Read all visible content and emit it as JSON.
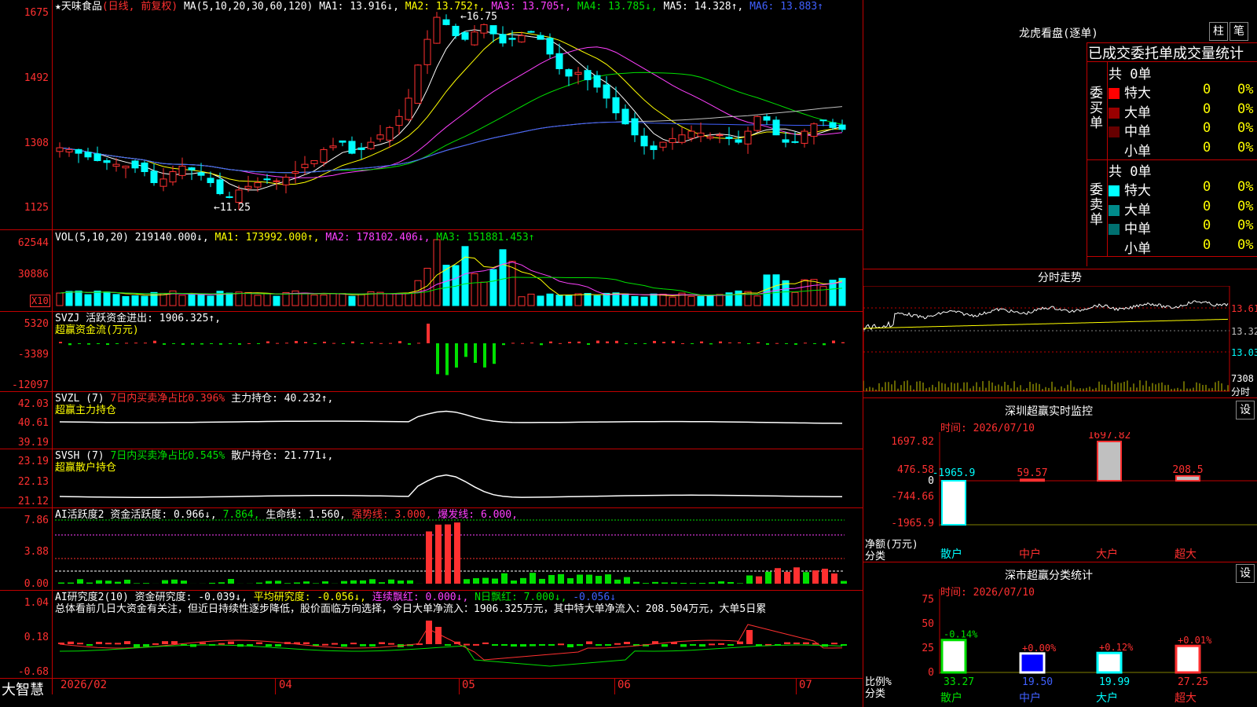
{
  "header": {
    "star": "★",
    "stock": "天味食品",
    "mode": "(日线, 前复权)",
    "ma_label": "MA(5,10,20,30,60,120)",
    "ma1": "MA1: 13.916↓,",
    "ma2": "MA2: 13.752↑,",
    "ma3": "MA3: 13.705↑,",
    "ma4": "MA4: 13.785↓,",
    "ma5": "MA5: 14.328↑,",
    "ma6": "MA6: 13.883↑",
    "high_mark": "16.75",
    "low_mark": "11.25"
  },
  "price_axis": [
    "1675",
    "1492",
    "1308",
    "1125"
  ],
  "vol": {
    "label": "VOL(5,10,20)",
    "val": "219140.000↓,",
    "ma1": "MA1: 173992.000↑,",
    "ma2": "MA2: 178102.406↓,",
    "ma3": "MA3: 151881.453↑",
    "axis": [
      "62544",
      "30886"
    ],
    "unit": "X10"
  },
  "svzj": {
    "label": "SVZJ  活跃资金进出: 1906.325↑,",
    "sub": "超赢资金流(万元)",
    "axis": [
      "5320",
      "-3389",
      "-12097"
    ]
  },
  "svzl": {
    "label": "SVZL (7)",
    "pct": "7日内买卖净占比0.396%",
    "hold": "主力持仓: 40.232↑,",
    "sub": "超赢主力持仓",
    "axis": [
      "42.03",
      "40.61",
      "39.19"
    ]
  },
  "svsh": {
    "label": "SVSH (7)",
    "pct": "7日内买卖净占比0.545%",
    "hold": "散户持仓: 21.771↓,",
    "sub": "超赢散户持仓",
    "axis": [
      "23.19",
      "22.13",
      "21.12"
    ]
  },
  "ai1": {
    "label": "AI活跃度2",
    "a": "资金活跃度: 0.966↓,",
    "b": "7.864,",
    "c": "生命线: 1.560,",
    "d": "强势线: 3.000,",
    "e": "爆发线: 6.000,",
    "axis": [
      "7.86",
      "3.88",
      "0.00"
    ]
  },
  "ai2": {
    "label": "AI研究度2(10)",
    "a": "资金研究度: -0.039↓,",
    "b": "平均研究度: -0.056↓,",
    "c": "连续飘红: 0.000↓,",
    "d": "N日飘红: 7.000↓,",
    "e": "-0.056↓",
    "text": "总体看前几日大资金有关注，但近日持续性逐步降低，股价面临方向选择，今日大单净流入：1906.325万元，其中特大单净流入：208.504万元，大单5日累",
    "axis": [
      "1.04",
      "0.18",
      "-0.68"
    ]
  },
  "xaxis": {
    "brand": "大智慧",
    "labels": [
      "2026/02",
      "04",
      "05",
      "06",
      "07"
    ]
  },
  "right": {
    "lhb_title": "龙虎看盘(逐单)",
    "btn1": "柱",
    "btn2": "笔",
    "tabs": "已成交委托单成交量统计",
    "buy_side": "委买单",
    "sell_side": "委卖单",
    "total": "共 0单",
    "rows": [
      {
        "name": "特大",
        "v": "0",
        "p": "0%",
        "buy": "#ff0000",
        "sell": "#00ffff"
      },
      {
        "name": "大单",
        "v": "0",
        "p": "0%",
        "buy": "#990000",
        "sell": "#008b8b"
      },
      {
        "name": "中单",
        "v": "0",
        "p": "0%",
        "buy": "#660000",
        "sell": "#007070"
      },
      {
        "name": "小单",
        "v": "0",
        "p": "0%",
        "buy": "#000000",
        "sell": "#000000"
      }
    ],
    "fenshi_title": "分时走势",
    "fenshi_axis": [
      "13.61",
      "13.32",
      "13.03"
    ],
    "fenshi_vol": "7308",
    "fenshi_unit": "分时",
    "sz_title": "深圳超赢实时监控",
    "sz_time": "时间: 2026/07/10",
    "sz_axis": [
      "1697.82",
      "476.58",
      "0",
      "-744.66",
      "-1965.9"
    ],
    "sz_unit": "净额(万元)",
    "sz_cat": "分类",
    "sz_cats": [
      "散户",
      "中户",
      "大户",
      "超大"
    ],
    "sz_vals": [
      "-1965.9",
      "59.57",
      "1697.82",
      "208.5"
    ],
    "cl_title": "深市超赢分类统计",
    "cl_time": "时间: 2026/07/10",
    "cl_axis": [
      "75",
      "50",
      "25",
      "0"
    ],
    "cl_unit": "比例%",
    "cl_cat": "分类",
    "cl_cats": [
      "散户",
      "中户",
      "大户",
      "超大"
    ],
    "cl_pct": [
      "-0.14%",
      "+0.00%",
      "+0.12%",
      "+0.01%"
    ],
    "cl_vals": [
      "33.27",
      "19.50",
      "19.99",
      "27.25"
    ],
    "set": "设"
  },
  "chart_data": {
    "type": "bar",
    "title": "",
    "categories": [
      "散户",
      "中户",
      "大户",
      "超大"
    ],
    "series": [
      {
        "name": "净额(万元)",
        "values": [
          -1965.9,
          59.57,
          1697.82,
          208.5
        ]
      },
      {
        "name": "比例%",
        "values": [
          33.27,
          19.5,
          19.99,
          27.25
        ]
      }
    ],
    "ylim": [
      -1965.9,
      1697.82
    ]
  },
  "colors": {
    "up": "#ff3030",
    "down": "#00ffff",
    "grid": "#c00000"
  }
}
